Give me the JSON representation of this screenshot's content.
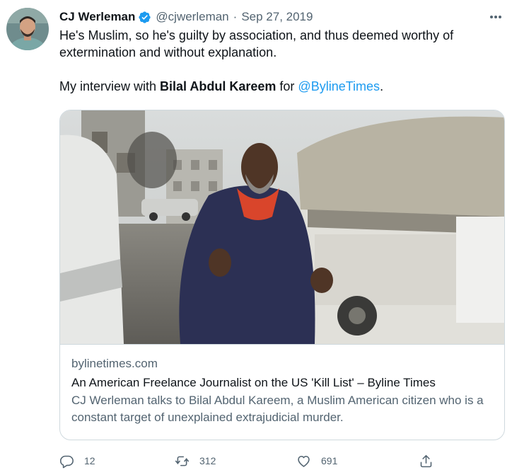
{
  "tweet": {
    "author": {
      "name": "CJ Werleman",
      "handle": "@cjwerleman",
      "separator": "·",
      "date": "Sep 27, 2019"
    },
    "text": {
      "line1": "He's Muslim, so he's guilty by association, and thus deemed worthy of extermination and without explanation.",
      "p2_prefix": "My interview with ",
      "p2_bold": "Bilal Abdul Kareem",
      "p2_mid": " for ",
      "p2_mention": "@BylineTimes",
      "p2_suffix": "."
    },
    "card": {
      "domain": "bylinetimes.com",
      "title": "An American Freelance Journalist on the US 'Kill List' – Byline Times",
      "description": "CJ Werleman talks to Bilal Abdul Kareem, a Muslim American citizen who is a constant target of unexplained extrajudicial murder."
    },
    "actions": {
      "reply_count": "12",
      "retweet_count": "312",
      "like_count": "691"
    }
  },
  "icons": {
    "verified": "verified-badge-icon",
    "more": "more-horizontal-icon",
    "reply": "reply-icon",
    "retweet": "retweet-icon",
    "like": "heart-icon",
    "share": "share-icon"
  },
  "colors": {
    "accent": "#1d9bf0",
    "text": "#0f1419",
    "secondary": "#536471",
    "border": "#cfd9de"
  }
}
